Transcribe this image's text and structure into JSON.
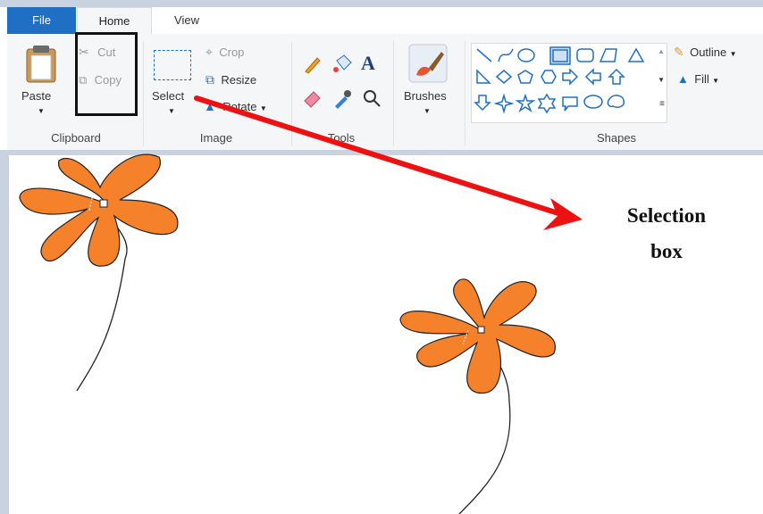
{
  "tabs": {
    "file": "File",
    "home": "Home",
    "view": "View"
  },
  "clipboard": {
    "paste": "Paste",
    "cut": "Cut",
    "copy": "Copy",
    "group": "Clipboard"
  },
  "image": {
    "select": "Select",
    "crop": "Crop",
    "resize": "Resize",
    "rotate": "Rotate",
    "group": "Image"
  },
  "tools": {
    "group": "Tools"
  },
  "brushes": {
    "label": "Brushes"
  },
  "shapes": {
    "group": "Shapes",
    "outline": "Outline",
    "fill": "Fill"
  },
  "annotation": {
    "line1": "Selection",
    "line2": "box"
  },
  "colors": {
    "file_tab": "#1f6fc5",
    "flower": "#f5822a",
    "arrow": "#ee1111",
    "shape_outline": "#1f6fc5"
  }
}
